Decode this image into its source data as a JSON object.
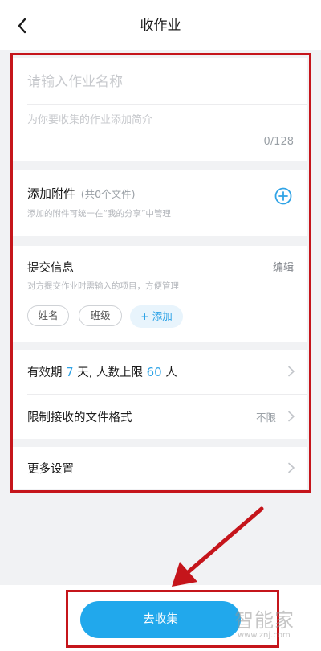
{
  "header": {
    "title": "收作业"
  },
  "form": {
    "name_placeholder": "请输入作业名称",
    "intro_placeholder": "为你要收集的作业添加简介",
    "counter": "0/128"
  },
  "attachments": {
    "title": "添加附件",
    "count": "(共0个文件)",
    "note": "添加的附件可统一在“我的分享”中管理"
  },
  "submission": {
    "title": "提交信息",
    "edit_label": "编辑",
    "note": "对方提交作业时需输入的项目，方便管理",
    "fields": [
      "姓名",
      "班级"
    ],
    "add_label": "+ 添加"
  },
  "validity": {
    "prefix": "有效期",
    "days": "7",
    "middle": "天, 人数上限",
    "limit": "60",
    "suffix": "人"
  },
  "format_row": {
    "label": "限制接收的文件格式",
    "value": "不限"
  },
  "more_settings": {
    "label": "更多设置"
  },
  "bottom": {
    "button_label": "去收集"
  },
  "watermark": {
    "text": "智能家",
    "url": "www.znj.com"
  },
  "colors": {
    "accent": "#21a8ec",
    "annotation": "#c5151b",
    "background": "#f1f2f4"
  }
}
